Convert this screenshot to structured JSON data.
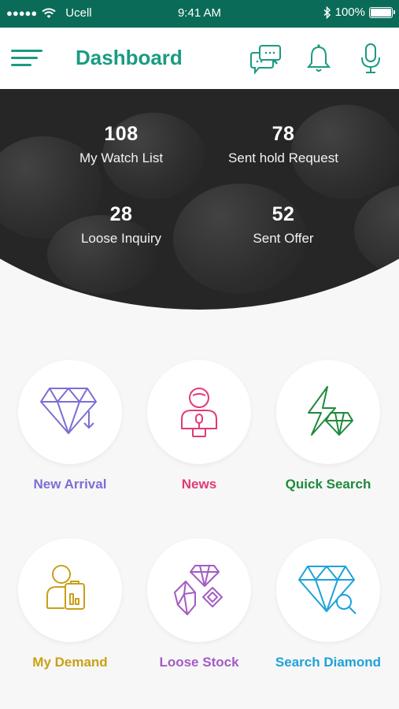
{
  "status_bar": {
    "signal": "●●●●●",
    "carrier": "Ucell",
    "time": "9:41 AM",
    "battery_percent": "100%",
    "icons": [
      "wifi-icon",
      "bluetooth-icon",
      "battery-icon"
    ]
  },
  "header": {
    "title": "Dashboard",
    "icons": [
      "menu-icon",
      "chat-icon",
      "bell-icon",
      "microphone-icon"
    ],
    "accent_color": "#1a9b82"
  },
  "stats": [
    {
      "value": "108",
      "label": "My Watch List"
    },
    {
      "value": "78",
      "label": "Sent hold Request"
    },
    {
      "value": "28",
      "label": "Loose Inquiry"
    },
    {
      "value": "52",
      "label": "Sent Offer"
    }
  ],
  "tiles": [
    {
      "label": "New Arrival",
      "icon": "diamond-download-icon",
      "color": "#7b6fd6"
    },
    {
      "label": "News",
      "icon": "news-person-icon",
      "color": "#e23a78"
    },
    {
      "label": "Quick Search",
      "icon": "lightning-diamond-icon",
      "color": "#1f8a3c"
    },
    {
      "label": "My Demand",
      "icon": "person-clipboard-icon",
      "color": "#c9a018"
    },
    {
      "label": "Loose Stock",
      "icon": "gems-icon",
      "color": "#a45bc4"
    },
    {
      "label": "Search Diamond",
      "icon": "diamond-search-icon",
      "color": "#1ea2d8"
    }
  ]
}
